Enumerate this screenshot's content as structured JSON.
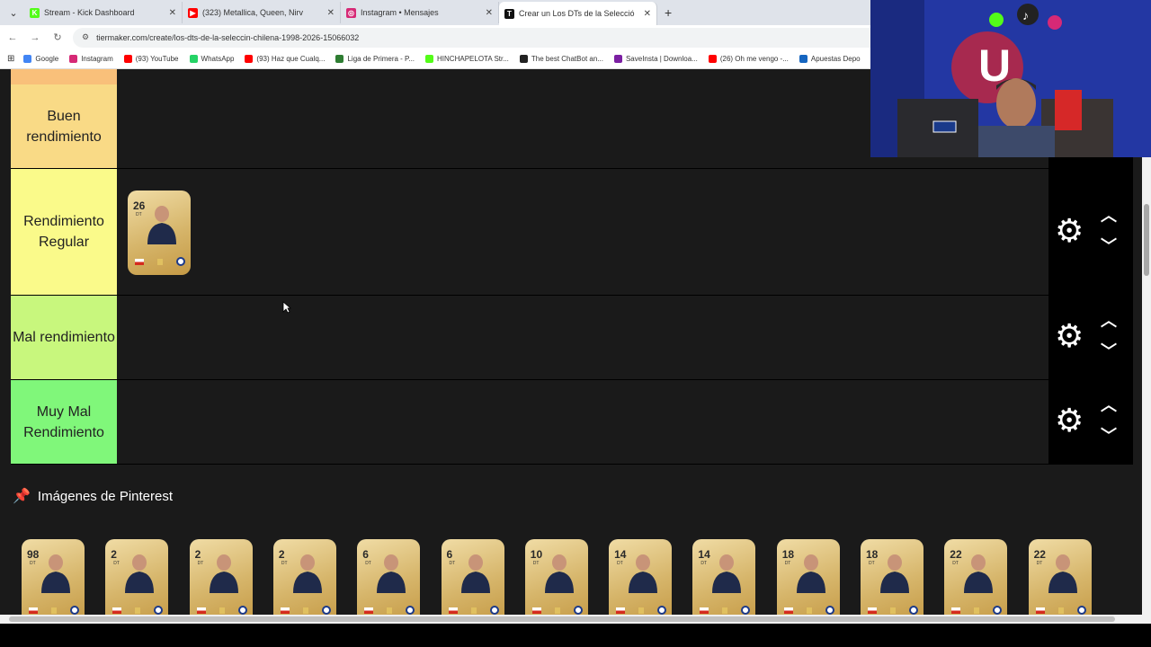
{
  "browser": {
    "tabs": [
      {
        "label": "Stream - Kick Dashboard",
        "fav_color": "#53fc18",
        "fav_glyph": "K",
        "active": false
      },
      {
        "label": "(323) Metallica, Queen, Nirv",
        "fav_color": "#ff0000",
        "fav_glyph": "▶",
        "active": false
      },
      {
        "label": "Instagram • Mensajes",
        "fav_color": "#d62976",
        "fav_glyph": "◎",
        "active": false
      },
      {
        "label": "Crear un Los DTs de la Selecció",
        "fav_color": "#111111",
        "fav_glyph": "T",
        "active": true
      }
    ],
    "new_tab": "+",
    "url": "tiermaker.com/create/los-dts-de-la-seleccin-chilena-1998-2026-15066032",
    "bookmarks": [
      {
        "label": "Google",
        "color": "#4285f4"
      },
      {
        "label": "Instagram",
        "color": "#d62976"
      },
      {
        "label": "(93) YouTube",
        "color": "#ff0000"
      },
      {
        "label": "WhatsApp",
        "color": "#25d366"
      },
      {
        "label": "(93) Haz que Cualq...",
        "color": "#ff0000"
      },
      {
        "label": "Liga de Primera - P...",
        "color": "#2e7d32"
      },
      {
        "label": "HINCHAPELOTA Str...",
        "color": "#53fc18"
      },
      {
        "label": "The best ChatBot an...",
        "color": "#222222"
      },
      {
        "label": "SaveInsta | Downloa...",
        "color": "#7b1fa2"
      },
      {
        "label": "(26) Oh me vengo -...",
        "color": "#ff0000"
      },
      {
        "label": "Apuestas Depo",
        "color": "#1565c0"
      }
    ]
  },
  "tiers": [
    {
      "label": "Buen rendimiento",
      "color": "#f9da86"
    },
    {
      "label": "Rendimiento Regular",
      "color": "#fafa8a"
    },
    {
      "label": "Mal rendimiento",
      "color": "#c8f77d"
    },
    {
      "label": "Muy Mal Rendimiento",
      "color": "#80f77a"
    }
  ],
  "tier_cards": [
    {
      "tier": 1,
      "rating": "26",
      "pos": "DT"
    }
  ],
  "controls": {
    "gear_icon": "gear-icon",
    "up_icon": "chevron-up-icon",
    "down_icon": "chevron-down-icon"
  },
  "pool": {
    "title": "Imágenes de Pinterest",
    "cards": [
      {
        "rating": "98",
        "pos": "DT"
      },
      {
        "rating": "2",
        "pos": "DT"
      },
      {
        "rating": "2",
        "pos": "DT"
      },
      {
        "rating": "2",
        "pos": "DT"
      },
      {
        "rating": "6",
        "pos": "DT"
      },
      {
        "rating": "6",
        "pos": "DT"
      },
      {
        "rating": "10",
        "pos": "DT"
      },
      {
        "rating": "14",
        "pos": "DT"
      },
      {
        "rating": "14",
        "pos": "DT"
      },
      {
        "rating": "18",
        "pos": "DT"
      },
      {
        "rating": "18",
        "pos": "DT"
      },
      {
        "rating": "22",
        "pos": "DT"
      },
      {
        "rating": "22",
        "pos": "DT"
      }
    ]
  }
}
